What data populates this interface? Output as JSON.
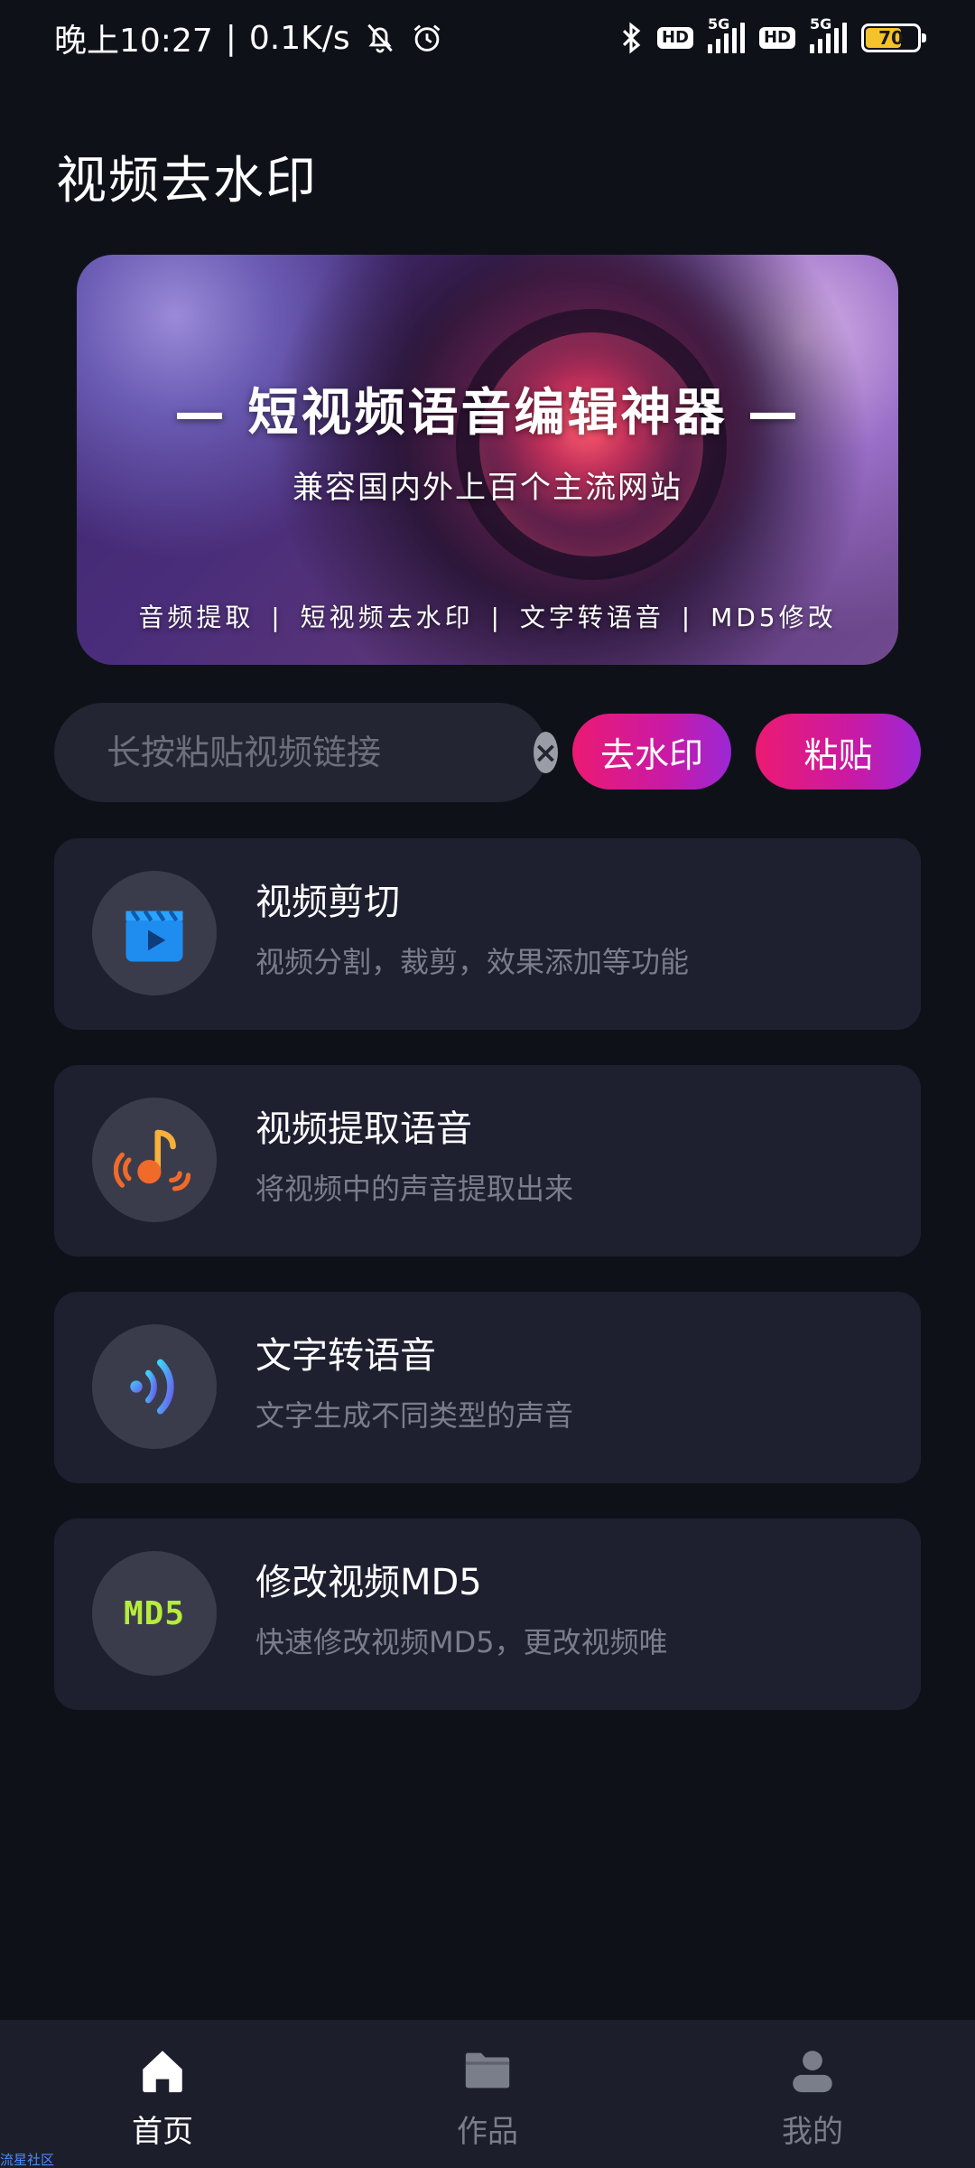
{
  "status_bar": {
    "time": "晚上10:27",
    "separator": "|",
    "speed": "0.1K/s",
    "battery": "70",
    "battery_fraction": 0.7,
    "network_labels": [
      "5G",
      "5G"
    ],
    "hd_labels": [
      "HD",
      "HD"
    ],
    "icons": [
      "mute-bell-icon",
      "alarm-icon",
      "bluetooth-icon",
      "signal-icon",
      "battery-icon"
    ]
  },
  "page": {
    "title": "视频去水印"
  },
  "banner": {
    "headline": "— 短视频语音编辑神器 —",
    "subline": "兼容国内外上百个主流网站",
    "features": "音频提取 | 短视频去水印 | 文字转语音 | MD5修改"
  },
  "search": {
    "placeholder": "长按粘贴视频链接",
    "value": "",
    "clear_icon": "close-icon"
  },
  "actions": {
    "remove_watermark": "去水印",
    "paste": "粘贴"
  },
  "colors": {
    "background": "#0f1119",
    "card": "#1e2030",
    "accent_start": "#ec1a72",
    "accent_end": "#9a28d6",
    "md5_green": "#b6ec3c"
  },
  "features": [
    {
      "title": "视频剪切",
      "desc": "视频分割，裁剪，效果添加等功能",
      "icon": "clapperboard-icon"
    },
    {
      "title": "视频提取语音",
      "desc": "将视频中的声音提取出来",
      "icon": "music-note-icon"
    },
    {
      "title": "文字转语音",
      "desc": "文字生成不同类型的声音",
      "icon": "sound-wave-icon"
    },
    {
      "title": "修改视频MD5",
      "desc": "快速修改视频MD5，更改视频唯",
      "icon": "md5-icon",
      "icon_text": "MD5"
    }
  ],
  "nav": [
    {
      "label": "首页",
      "icon": "home-icon",
      "active": true
    },
    {
      "label": "作品",
      "icon": "folder-icon",
      "active": false
    },
    {
      "label": "我的",
      "icon": "user-icon",
      "active": false
    }
  ],
  "watermark": "流星社区"
}
